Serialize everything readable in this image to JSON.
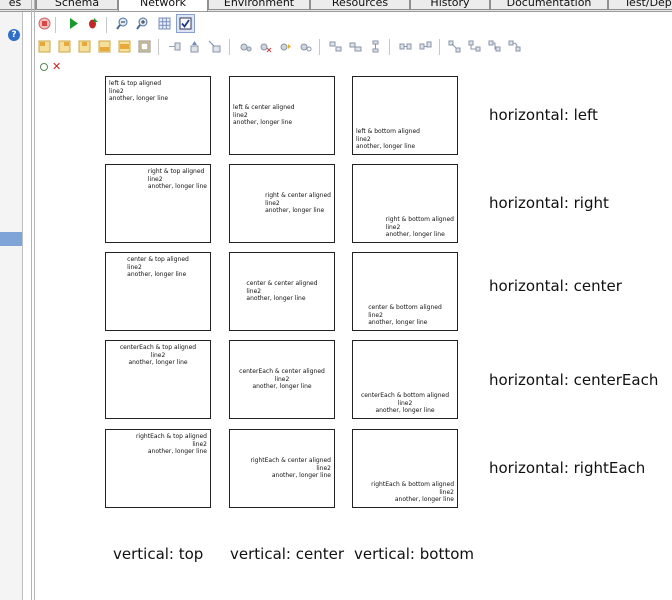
{
  "tabs": [
    {
      "label": "es",
      "active": false
    },
    {
      "label": "Schema",
      "active": false
    },
    {
      "label": "Network",
      "active": true
    },
    {
      "label": "Environment",
      "active": false
    },
    {
      "label": "Resources",
      "active": false
    },
    {
      "label": "History",
      "active": false
    },
    {
      "label": "Documentation",
      "active": false
    },
    {
      "label": "Test/Dep",
      "active": false
    }
  ],
  "toolbar_row1": [
    {
      "icon": "stop-icon"
    },
    {
      "icon": "run-icon"
    },
    {
      "icon": "debug-bug-icon"
    },
    {
      "icon": "zoom-out-icon"
    },
    {
      "icon": "zoom-in-icon"
    },
    {
      "icon": "grid-icon"
    },
    {
      "icon": "checkbox-toggle-icon"
    }
  ],
  "toolbar_row2": [
    {
      "icon": "align-top-left-icon"
    },
    {
      "icon": "align-top-right-icon"
    },
    {
      "icon": "align-top-center-icon"
    },
    {
      "icon": "align-bottom-icon"
    },
    {
      "icon": "align-middle-icon"
    },
    {
      "icon": "align-fill-icon"
    },
    {
      "icon": "add-node-icon"
    },
    {
      "icon": "move-up-icon"
    },
    {
      "icon": "move-down-icon"
    },
    {
      "icon": "add-port-icon"
    },
    {
      "icon": "remove-port-icon"
    },
    {
      "icon": "connect-port-icon"
    },
    {
      "icon": "port-settings-icon"
    },
    {
      "icon": "stack-horizontal-icon"
    },
    {
      "icon": "stack-vertical-icon"
    },
    {
      "icon": "stack-center-icon"
    },
    {
      "icon": "distribute-horizontal-icon"
    },
    {
      "icon": "distribute-vertical-icon"
    },
    {
      "icon": "route-link-icon"
    },
    {
      "icon": "route-straight-icon"
    },
    {
      "icon": "route-orthogonal-icon"
    },
    {
      "icon": "route-curved-icon"
    }
  ],
  "canvas_controls": {
    "select_icon": "node-select-icon",
    "close_icon": "close-icon",
    "close_glyph": "✕"
  },
  "help_glyph": "?",
  "rows": [
    {
      "label": "horizontal: left",
      "cells": [
        {
          "h": "left",
          "v": "top",
          "lines": [
            "left & top aligned",
            "line2",
            "another, longer line"
          ]
        },
        {
          "h": "left",
          "v": "center",
          "lines": [
            "left & center aligned",
            "line2",
            "another, longer line"
          ]
        },
        {
          "h": "left",
          "v": "bottom",
          "lines": [
            "left & bottom aligned",
            "line2",
            "another, longer line"
          ]
        }
      ]
    },
    {
      "label": "horizontal: right",
      "cells": [
        {
          "h": "right",
          "v": "top",
          "lines": [
            "right & top aligned",
            "line2",
            "another, longer line"
          ]
        },
        {
          "h": "right",
          "v": "center",
          "lines": [
            "right & center aligned",
            "line2",
            "another, longer line"
          ]
        },
        {
          "h": "right",
          "v": "bottom",
          "lines": [
            "right & bottom aligned",
            "line2",
            "another, longer line"
          ]
        }
      ]
    },
    {
      "label": "horizontal: center",
      "cells": [
        {
          "h": "center",
          "v": "top",
          "lines": [
            "center & top aligned",
            "line2",
            "another, longer line"
          ]
        },
        {
          "h": "center",
          "v": "center",
          "lines": [
            "center & center aligned",
            "line2",
            "another, longer line"
          ]
        },
        {
          "h": "center",
          "v": "bottom",
          "lines": [
            "center & bottom aligned",
            "line2",
            "another, longer line"
          ]
        }
      ]
    },
    {
      "label": "horizontal: centerEach",
      "cells": [
        {
          "h": "centerEach",
          "v": "top",
          "lines": [
            "centerEach & top aligned",
            "line2",
            "another, longer line"
          ]
        },
        {
          "h": "centerEach",
          "v": "center",
          "lines": [
            "centerEach & center aligned",
            "line2",
            "another, longer line"
          ]
        },
        {
          "h": "centerEach",
          "v": "bottom",
          "lines": [
            "centerEach & bottom aligned",
            "line2",
            "another, longer line"
          ]
        }
      ]
    },
    {
      "label": "horizontal: rightEach",
      "cells": [
        {
          "h": "rightEach",
          "v": "top",
          "lines": [
            "rightEach & top aligned",
            "line2",
            "another, longer line"
          ]
        },
        {
          "h": "rightEach",
          "v": "center",
          "lines": [
            "rightEach & center aligned",
            "line2",
            "another, longer line"
          ]
        },
        {
          "h": "rightEach",
          "v": "bottom",
          "lines": [
            "rightEach & bottom aligned",
            "line2",
            "another, longer line"
          ]
        }
      ]
    }
  ],
  "columns": [
    "vertical: top",
    "vertical: center",
    "vertical: bottom"
  ]
}
